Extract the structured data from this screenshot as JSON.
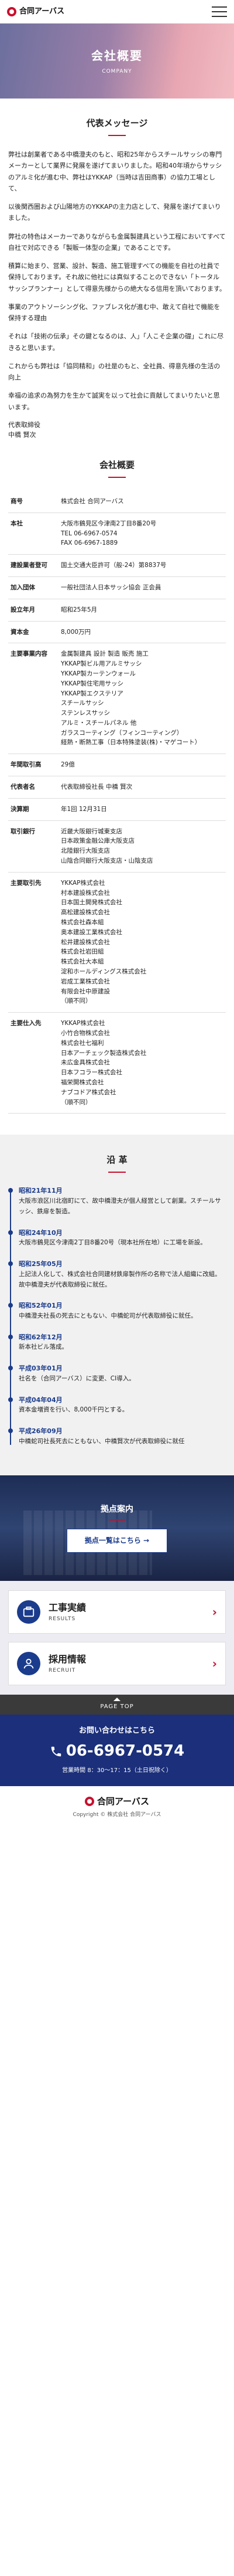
{
  "header": {
    "logo_text": "合同アーバス"
  },
  "hero": {
    "title": "会社概要",
    "subtitle": "COMPANY"
  },
  "message": {
    "title": "代表メッセージ",
    "paragraphs": [
      "弊社は創業者である中橋澄夫のもと、昭和25年からスチールサッシの専門メーカーとして業界に発展を遂げてまいりました。昭和40年頃からサッシのアルミ化が進む中、弊社はYKKAP（当時は吉田商事）の協力工場として、",
      "以後関西圏および山陽地方のYKKAPの主力店として、発展を遂げてまいりました。",
      "弊社の特色はメーカーでありながらも金属製建具という工程においてすべて自社で対応できる「製販一体型の企業」であることです。",
      "積算に始まり、営業、設計、製造、施工管理すべての機能を自社の社員で保持しております。それ故に他社には真似することのできない「トータルサッシプランナー」として得意先様からの絶大なる信用を頂いております。",
      "事業のアウトソーシング化、ファブレス化が進む中、敢えて自社で機能を保持する理由",
      "それは「技術の伝承」その鍵となるのは、人」「人こそ企業の礎」これに尽きると思います。",
      "これからも弊社は「協同精和」の社是のもと、全社員、得意先様の生活の向上",
      "幸福の追求の為努力を生かて誠実を以って社会に貢献してまいりたいと思います。"
    ],
    "sign_role": "代表取締役",
    "sign_name": "中橋 賢次"
  },
  "profile": {
    "title": "会社概要",
    "rows": [
      {
        "label": "商号",
        "lines": [
          "株式会社 合同アーバス"
        ]
      },
      {
        "label": "本社",
        "lines": [
          "大阪市鶴見区今津南2丁目8番20号",
          "TEL 06-6967-0574",
          "FAX 06-6967-1889"
        ]
      },
      {
        "label": "建設業者登可",
        "lines": [
          "国土交通大臣許可（般-24）第8837号"
        ]
      },
      {
        "label": "加入団体",
        "lines": [
          "一般社団法人日本サッシ協会 正会員"
        ]
      },
      {
        "label": "設立年月",
        "lines": [
          "昭和25年5月"
        ]
      },
      {
        "label": "資本金",
        "lines": [
          "8,000万円"
        ]
      },
      {
        "label": "主要事業内容",
        "lines": [
          "金属製建具 設計 製造 販売 施工",
          "YKKAP製ビル用アルミサッシ",
          "YKKAP製カーテンウォール",
          "YKKAP製住宅用サッシ",
          "YKKAP製エクステリア",
          "スチールサッシ",
          "ステンレスサッシ",
          "アルミ・スチールパネル 他",
          "ガラスコーティング（フィンコーティング）",
          "経熱・断熱工事（日本特殊塗装(株)・マゲコート）"
        ]
      },
      {
        "label": "年間取引高",
        "lines": [
          "29億"
        ]
      },
      {
        "label": "代表者名",
        "lines": [
          "代表取締役社長 中橋 賢次"
        ]
      },
      {
        "label": "決算期",
        "lines": [
          "年1回 12月31日"
        ]
      },
      {
        "label": "取引銀行",
        "lines": [
          "近畿大阪銀行城東支店",
          "日本政策金融公庫大阪支店",
          "北陸銀行大阪支店",
          "山陰合同銀行大阪支店・山陰支店"
        ]
      },
      {
        "label": "主要取引先",
        "lines": [
          "YKKAP株式会社",
          "村本建設株式会社",
          "日本国土開発株式会社",
          "高松建設株式会社",
          "株式会社森本組",
          "奥本建設工業株式会社",
          "松井建設株式会社",
          "株式会社岩田組",
          "株式会社大本組",
          "淀和ホールディングス株式会社",
          "岩成工業株式会社",
          "有限会社中原建設",
          "（順不同）"
        ]
      },
      {
        "label": "主要仕入先",
        "lines": [
          "YKKAP株式会社",
          "小竹合物株式会社",
          "株式会社七福利",
          "日本アーチェック製造株式会社",
          "未広金具株式会社",
          "日本フコラー株式会社",
          "福栄開株式会社",
          "ナブコドア株式会社",
          "（順不同）"
        ]
      }
    ]
  },
  "history": {
    "title": "沿 革",
    "items": [
      {
        "date": "昭和21年11月",
        "text": "大阪市浪区川北宿町にて、故中橋澄夫が個人経営として創業。スチールサッシ、鉄扉を製造。"
      },
      {
        "date": "昭和24年10月",
        "text": "大阪市鶴見区今津南2丁目8番20号（現本社所在地）に工場を新設。"
      },
      {
        "date": "昭和25年05月",
        "text": "上記法人化して、株式会社合同建材鉄扉製作所の名称で法人組織に改組。故中橋澄夫が代表取締役に就任。"
      },
      {
        "date": "昭和52年01月",
        "text": "中橋澄夫社長の死去にともない、中橋蛇司が代表取締役に就任。"
      },
      {
        "date": "昭和62年12月",
        "text": "新本社ビル落成。"
      },
      {
        "date": "平成03年01月",
        "text": "社名を（合同アーバス）に変更、CI導入。"
      },
      {
        "date": "平成04年04月",
        "text": "資本金増資を行い、8,000千円とする。"
      },
      {
        "date": "平成26年09月",
        "text": "中橋蛇司社長死去にともない、中橋賢次が代表取締役に就任"
      }
    ]
  },
  "bases": {
    "title": "拠点案内",
    "button_label": "拠点一覧はこちら →"
  },
  "cards": [
    {
      "ja": "工事実績",
      "en": "RESULTS"
    },
    {
      "ja": "採用情報",
      "en": "RECRUIT"
    }
  ],
  "pagetop": {
    "label": "PAGE TOP"
  },
  "contact": {
    "title": "お問い合わせはこちら",
    "tel": "06-6967-0574",
    "hours": "営業時間 8：30～17：15（土日祝除く）"
  },
  "footer": {
    "logo_text": "合同アーバス",
    "copyright": "Copyright © 株式会社 合同アーバス"
  }
}
